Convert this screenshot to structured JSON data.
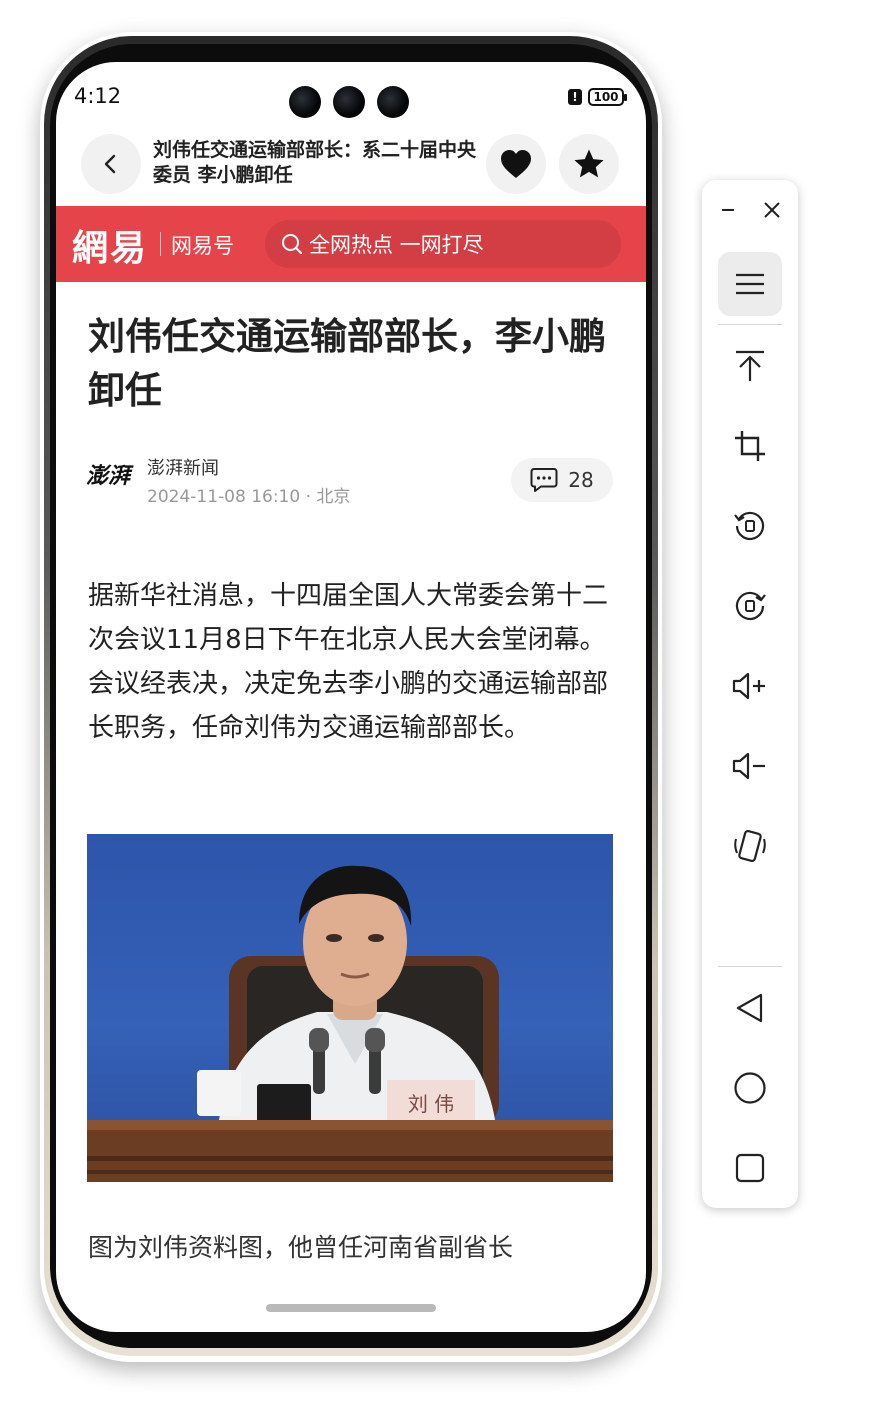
{
  "status_bar": {
    "time": "4:12",
    "battery": "100",
    "alert": "!"
  },
  "header": {
    "title": "刘伟任交通运输部部长：系二十届中央委员 李小鹏卸任",
    "back_icon": "chevron-left-icon",
    "like_icon": "heart-icon",
    "favorite_icon": "star-icon"
  },
  "banner": {
    "logo": "網易",
    "label": "网易号",
    "search_text": "全网热点 一网打尽",
    "color": "#e5444a"
  },
  "article": {
    "title": "刘伟任交通运输部部长，李小鹏卸任",
    "source_logo": "澎湃",
    "source": "澎湃新闻",
    "meta": "2024-11-08 16:10 · 北京",
    "comment_count": "28",
    "body": "据新华社消息，十四届全国人大常委会第十二次会议11月8日下午在北京人民大会堂闭幕。会议经表决，决定免去李小鹏的交通运输部部长职务，任命刘伟为交通运输部部长。",
    "nameplate": "刘 伟",
    "caption": "图为刘伟资料图，他曾任河南省副省长"
  },
  "toolbar": {
    "items": [
      "menu-icon",
      "pin-to-top-icon",
      "crop-icon",
      "rotate-left-icon",
      "rotate-right-icon",
      "volume-up-icon",
      "volume-down-icon",
      "shake-icon",
      "back-triangle-icon",
      "home-circle-icon",
      "recents-square-icon"
    ],
    "minimize_icon": "minimize-icon",
    "close_icon": "close-icon"
  }
}
